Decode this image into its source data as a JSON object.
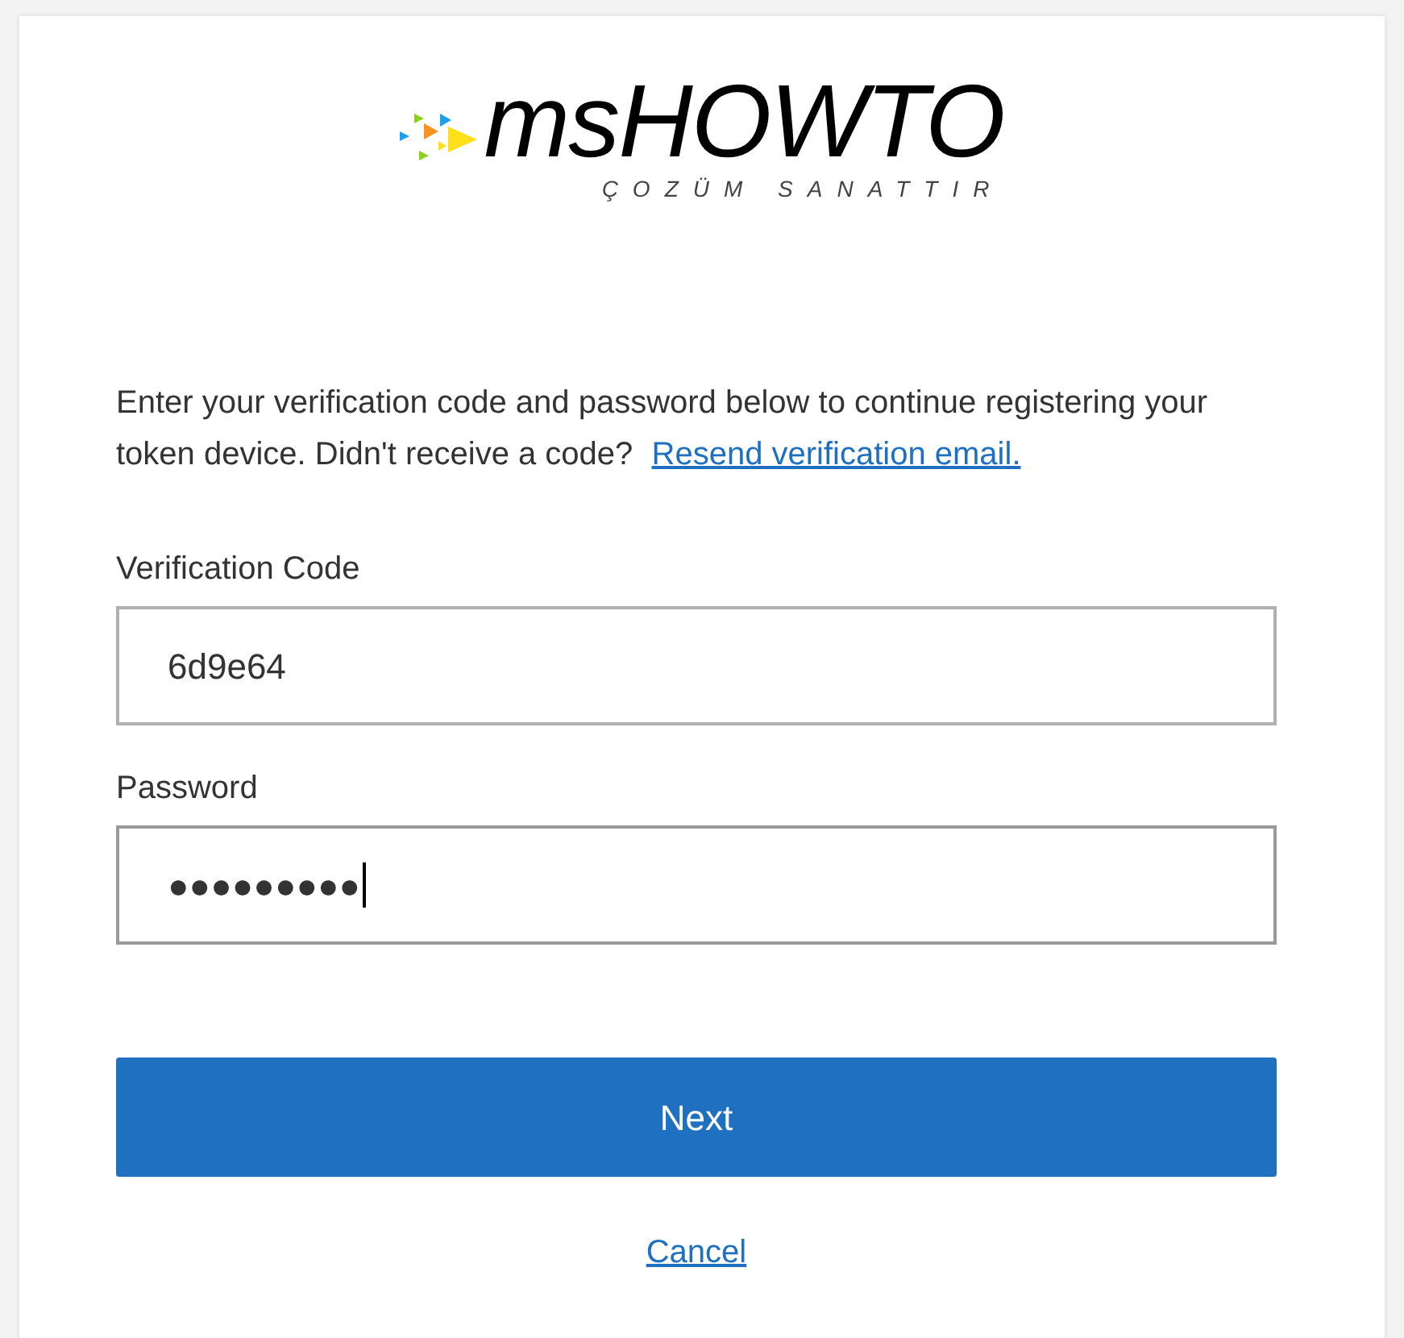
{
  "logo": {
    "title": "msHOWTO",
    "tagline": "ÇOZÜM SANATTIR"
  },
  "intro": {
    "text": "Enter your verification code and password below to continue registering your token device. Didn't receive a code?",
    "link": "Resend verification email."
  },
  "fields": [
    {
      "label": "Verification Code",
      "value": "6d9e64",
      "focused": false
    },
    {
      "label": "Password",
      "value": "●●●●●●●●●",
      "focused": true
    }
  ],
  "primary_button": "Next",
  "cancel_link": "Cancel"
}
